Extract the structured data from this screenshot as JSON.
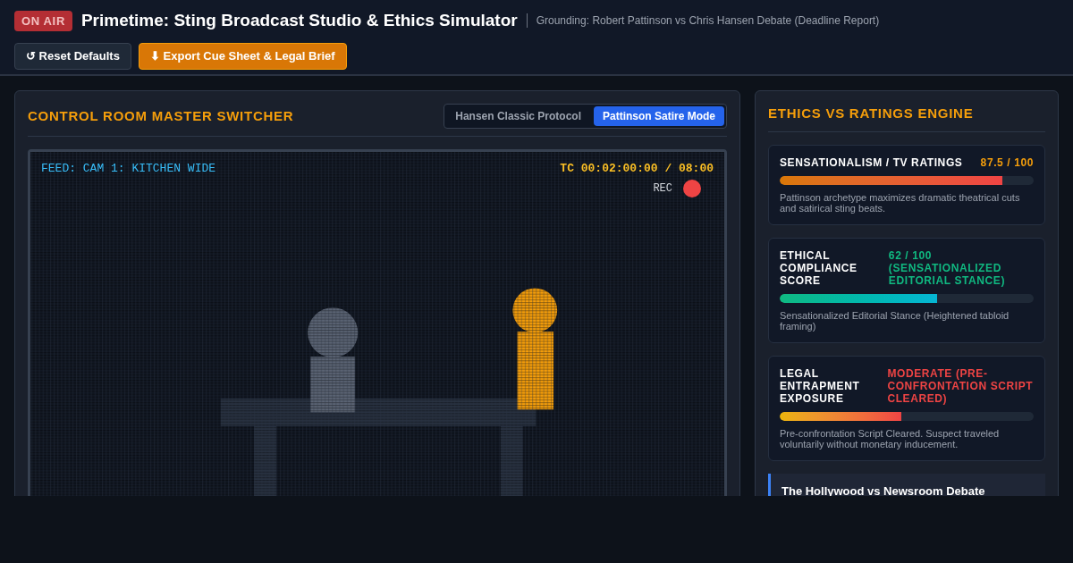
{
  "header": {
    "badge": "ON AIR",
    "title": "Primetime: Sting Broadcast Studio & Ethics Simulator",
    "grounding": "Grounding: Robert Pattinson vs Chris Hansen Debate (Deadline Report)",
    "buttons": [
      {
        "label": "↺ Reset Defaults",
        "kind": "secondary"
      },
      {
        "label": "⬇ Export Cue Sheet & Legal Brief",
        "kind": "primary"
      }
    ]
  },
  "switcher": {
    "title": "CONTROL ROOM MASTER SWITCHER",
    "modes": [
      {
        "label": "Hansen Classic Protocol",
        "selected": false
      },
      {
        "label": "Pattinson Satire Mode",
        "selected": true
      }
    ],
    "monitor": {
      "feed": "FEED: CAM 1: KITCHEN WIDE",
      "timecode": "TC 00:02:00:00 / 08:00",
      "rec": "REC"
    }
  },
  "engine": {
    "title": "ETHICS VS RATINGS ENGINE",
    "metrics": [
      {
        "kind": "ratings",
        "label": "SENSATIONALISM / TV RATINGS",
        "value": "87.5 / 100",
        "level": 0.875,
        "note": "Pattinson archetype maximizes dramatic theatrical cuts and satirical sting beats."
      },
      {
        "kind": "ethics",
        "label": "ETHICAL COMPLIANCE SCORE",
        "value": "62 / 100 (SENSATIONALIZED EDITORIAL STANCE)",
        "level": 0.62,
        "note": "Sensationalized Editorial Stance (Heightened tabloid framing)"
      },
      {
        "kind": "legal",
        "label": "LEGAL ENTRAPMENT EXPOSURE",
        "value": "MODERATE (PRE-CONFRONTATION SCRIPT CLEARED)",
        "level": 0.48,
        "note": "Pre-confrontation Script Cleared. Suspect traveled voluntarily without monetary inducement."
      }
    ],
    "debate": {
      "title": "The Hollywood vs Newsroom Debate"
    }
  }
}
